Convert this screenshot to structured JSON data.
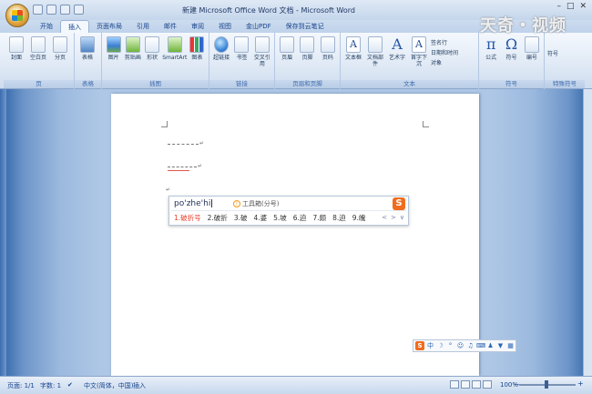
{
  "window": {
    "title": "新建 Microsoft Office Word 文档 - Microsoft Word",
    "watermark": "天奇・视频"
  },
  "tabs": [
    "开始",
    "插入",
    "页面布局",
    "引用",
    "邮件",
    "审阅",
    "视图",
    "金山PDF",
    "保存到云笔记"
  ],
  "ribbon": {
    "groups": [
      {
        "label": "页",
        "buttons": [
          "封面",
          "空白页",
          "分页"
        ]
      },
      {
        "label": "表格",
        "buttons": [
          "表格"
        ]
      },
      {
        "label": "插图",
        "buttons": [
          "图片",
          "剪贴画",
          "形状",
          "SmartArt",
          "图表"
        ]
      },
      {
        "label": "链接",
        "buttons": [
          "超链接",
          "书签",
          "交叉引用"
        ]
      },
      {
        "label": "页眉和页脚",
        "buttons": [
          "页眉",
          "页脚",
          "页码"
        ]
      },
      {
        "label": "文本",
        "buttons": [
          "文本框",
          "文档部件",
          "艺术字",
          "首字下沉"
        ],
        "small": [
          "签名行",
          "日期和时间",
          "对象"
        ]
      },
      {
        "label": "符号",
        "buttons": [
          "公式",
          "符号",
          "编号"
        ]
      },
      {
        "label": "特殊符号",
        "small": [
          "符号"
        ]
      }
    ]
  },
  "ime": {
    "pinyin": "po'zhe'hi",
    "hint": "工具箱(分号)",
    "candidates": [
      "1.破折号",
      "2.破折",
      "3.破",
      "4.婆",
      "5.坡",
      "6.迫",
      "7.颇",
      "8.迫",
      "9.魄"
    ],
    "nav_prev": "<",
    "nav_next": ">",
    "expand": "∨",
    "logo": "S"
  },
  "imebar": {
    "logo": "S",
    "lang": "中",
    "icons": [
      "moon-icon",
      "punct-icon",
      "smile-icon",
      "mic-icon",
      "keyboard-icon",
      "person-icon",
      "shirt-icon",
      "grid-icon"
    ]
  },
  "statusbar": {
    "page": "页面: 1/1",
    "words": "字数: 1",
    "lang": "中文(简体，中国)",
    "mode": "插入",
    "zoom": "100%",
    "zoom_minus": "－",
    "zoom_plus": "+"
  },
  "document": {
    "paragraph_marks": [
      "↵",
      "↵",
      "↵"
    ]
  }
}
